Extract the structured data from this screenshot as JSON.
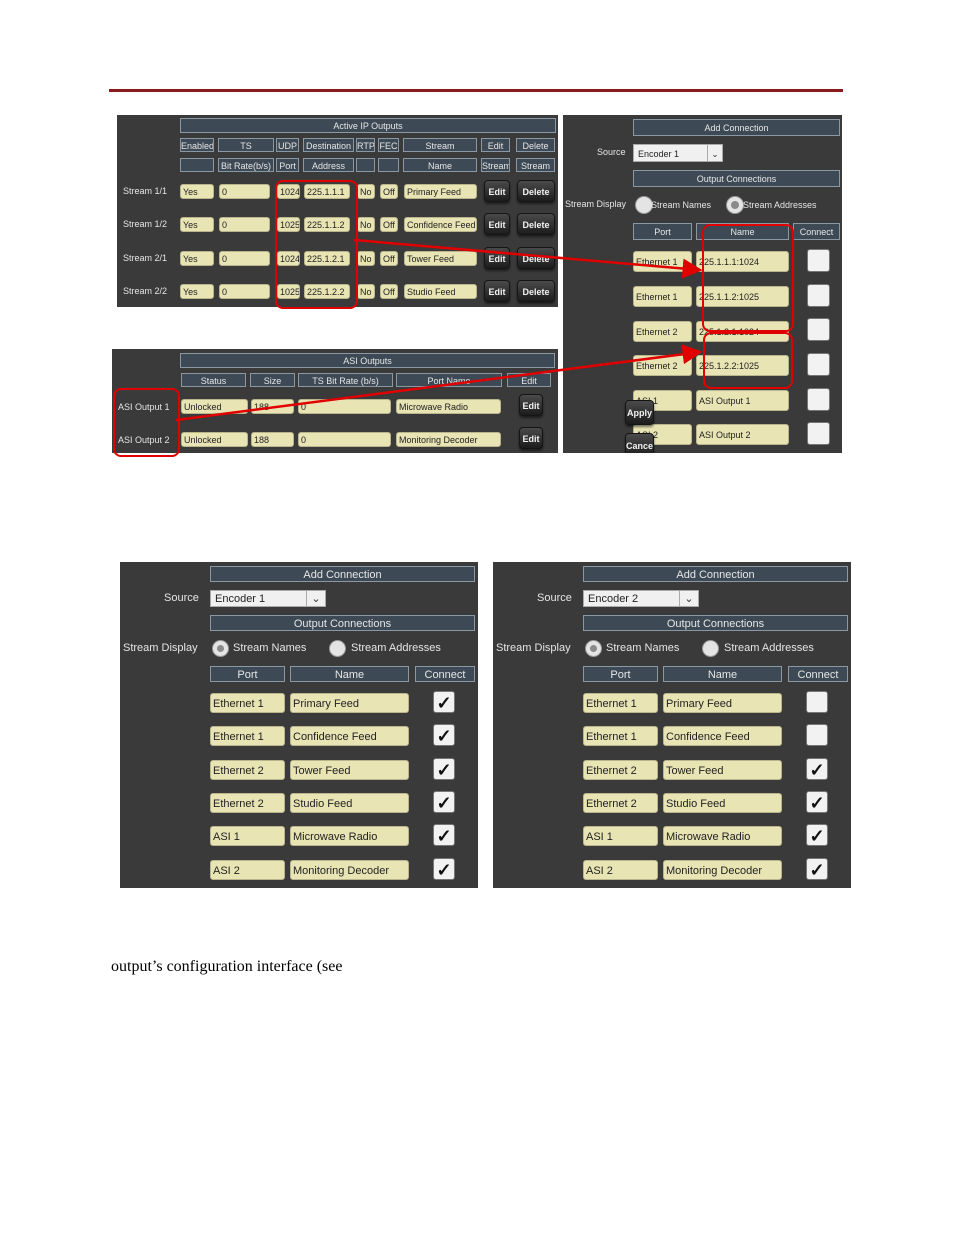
{
  "colors": {
    "accent_rule": "#8b1a1a",
    "highlight": "#e00000",
    "panel_bg": "#3a3a3a",
    "field_bg": "#e8e4b4"
  },
  "ip_outputs": {
    "title": "Active IP Outputs",
    "header_row1": [
      "Enabled",
      "TS",
      "UDP",
      "Destination",
      "RTP",
      "FEC",
      "Stream",
      "Edit",
      "Delete"
    ],
    "header_row2": [
      "",
      "Bit Rate(b/s)",
      "Port",
      "Address",
      "",
      "",
      "Name",
      "Stream",
      "Stream"
    ],
    "rows": [
      {
        "label": "Stream 1/1",
        "enabled": "Yes",
        "bitrate": "0",
        "port": "1024",
        "address": "225.1.1.1",
        "rtp": "No",
        "fec": "Off",
        "name": "Primary Feed",
        "edit": "Edit",
        "delete": "Delete"
      },
      {
        "label": "Stream 1/2",
        "enabled": "Yes",
        "bitrate": "0",
        "port": "1025",
        "address": "225.1.1.2",
        "rtp": "No",
        "fec": "Off",
        "name": "Confidence Feed",
        "edit": "Edit",
        "delete": "Delete"
      },
      {
        "label": "Stream 2/1",
        "enabled": "Yes",
        "bitrate": "0",
        "port": "1024",
        "address": "225.1.2.1",
        "rtp": "No",
        "fec": "Off",
        "name": "Tower Feed",
        "edit": "Edit",
        "delete": "Delete"
      },
      {
        "label": "Stream 2/2",
        "enabled": "Yes",
        "bitrate": "0",
        "port": "1025",
        "address": "225.1.2.2",
        "rtp": "No",
        "fec": "Off",
        "name": "Studio Feed",
        "edit": "Edit",
        "delete": "Delete"
      }
    ]
  },
  "asi_outputs": {
    "title": "ASI Outputs",
    "headers": [
      "Status",
      "Size",
      "TS Bit Rate (b/s)",
      "Port Name",
      "Edit"
    ],
    "rows": [
      {
        "label": "ASI Output 1",
        "status": "Unlocked",
        "size": "188",
        "bitrate": "0",
        "port_name": "Microwave Radio",
        "edit": "Edit"
      },
      {
        "label": "ASI Output 2",
        "status": "Unlocked",
        "size": "188",
        "bitrate": "0",
        "port_name": "Monitoring Decoder",
        "edit": "Edit"
      }
    ]
  },
  "add_connection_small": {
    "title": "Add Connection",
    "source_label": "Source",
    "source_value": "Encoder 1",
    "output_connections": "Output Connections",
    "stream_display_label": "Stream Display",
    "radio_names": "Stream Names",
    "radio_addresses": "Stream Addresses",
    "selected_display": "Stream Addresses",
    "col_port": "Port",
    "col_name": "Name",
    "col_connect": "Connect",
    "rows": [
      {
        "port": "Ethernet 1",
        "name": "225.1.1.1:1024",
        "connected": false
      },
      {
        "port": "Ethernet 1",
        "name": "225.1.1.2:1025",
        "connected": false
      },
      {
        "port": "Ethernet 2",
        "name": "225.1.2.1:1024",
        "connected": false
      },
      {
        "port": "Ethernet 2",
        "name": "225.1.2.2:1025",
        "connected": false
      },
      {
        "port": "ASI 1",
        "name": "ASI Output 1",
        "connected": false
      },
      {
        "port": "ASI 2",
        "name": "ASI Output 2",
        "connected": false
      }
    ],
    "apply": "Apply",
    "cancel": "Cancel"
  },
  "add_connection_enc1": {
    "title": "Add Connection",
    "source_label": "Source",
    "source_value": "Encoder 1",
    "output_connections": "Output Connections",
    "stream_display_label": "Stream Display",
    "radio_names": "Stream Names",
    "radio_addresses": "Stream Addresses",
    "selected_display": "Stream Names",
    "col_port": "Port",
    "col_name": "Name",
    "col_connect": "Connect",
    "rows": [
      {
        "port": "Ethernet 1",
        "name": "Primary Feed",
        "connected": true
      },
      {
        "port": "Ethernet 1",
        "name": "Confidence Feed",
        "connected": true
      },
      {
        "port": "Ethernet 2",
        "name": "Tower Feed",
        "connected": true
      },
      {
        "port": "Ethernet 2",
        "name": "Studio Feed",
        "connected": true
      },
      {
        "port": "ASI 1",
        "name": "Microwave Radio",
        "connected": true
      },
      {
        "port": "ASI 2",
        "name": "Monitoring Decoder",
        "connected": true
      }
    ]
  },
  "add_connection_enc2": {
    "title": "Add Connection",
    "source_label": "Source",
    "source_value": "Encoder 2",
    "output_connections": "Output Connections",
    "stream_display_label": "Stream Display",
    "radio_names": "Stream Names",
    "radio_addresses": "Stream Addresses",
    "selected_display": "Stream Names",
    "col_port": "Port",
    "col_name": "Name",
    "col_connect": "Connect",
    "rows": [
      {
        "port": "Ethernet 1",
        "name": "Primary Feed",
        "connected": false
      },
      {
        "port": "Ethernet 1",
        "name": "Confidence Feed",
        "connected": false
      },
      {
        "port": "Ethernet 2",
        "name": "Tower Feed",
        "connected": true
      },
      {
        "port": "Ethernet 2",
        "name": "Studio Feed",
        "connected": true
      },
      {
        "port": "ASI 1",
        "name": "Microwave Radio",
        "connected": true
      },
      {
        "port": "ASI 2",
        "name": "Monitoring Decoder",
        "connected": true
      }
    ]
  },
  "body_text": "output’s configuration interface (see"
}
